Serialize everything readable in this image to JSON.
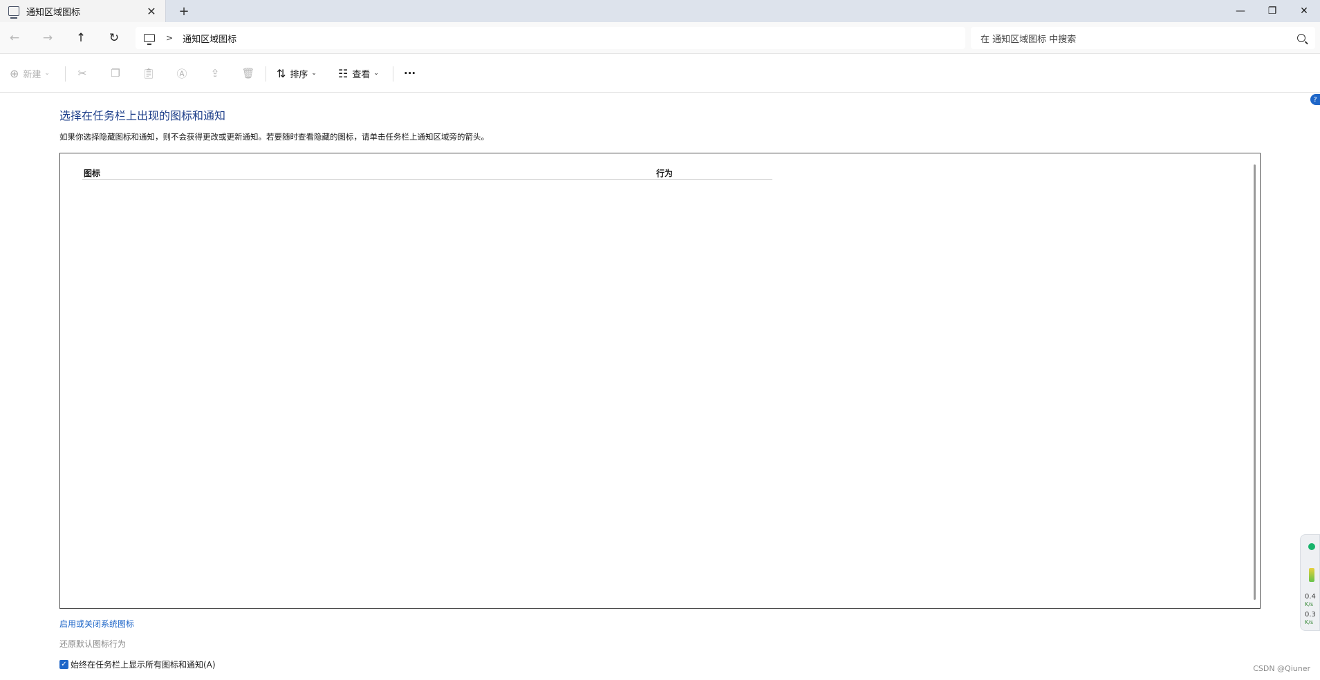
{
  "tab": {
    "title": "通知区域图标",
    "close": "✕",
    "new_tab": "+"
  },
  "window_controls": {
    "minimize": "—",
    "maximize": "❐",
    "close": "✕"
  },
  "nav": {
    "back": "←",
    "forward": "→",
    "up": "↑",
    "refresh": "↻"
  },
  "address": {
    "separator": ">",
    "path": "通知区域图标"
  },
  "search": {
    "placeholder": "在 通知区域图标 中搜索"
  },
  "toolbar": {
    "new_label": "新建",
    "sort_label": "排序",
    "view_label": "查看",
    "more_label": "···"
  },
  "content": {
    "heading": "选择在任务栏上出现的图标和通知",
    "description": "如果你选择隐藏图标和通知，则不会获得更改或更新通知。若要随时查看隐藏的图标，请单击任务栏上通知区域旁的箭头。",
    "columns": {
      "icon": "图标",
      "action": "行为"
    },
    "link_system_icons": "启用或关闭系统图标",
    "link_restore": "还原默认图标行为",
    "checkbox_label": "始终在任务栏上显示所有图标和通知(A)",
    "checkbox_checked": true
  },
  "help": {
    "label": "?"
  },
  "widget": {
    "upload": "0.4",
    "upload_unit": "K/s",
    "download": "0.3",
    "download_unit": "K/s"
  },
  "watermark": "CSDN @Qiuner"
}
